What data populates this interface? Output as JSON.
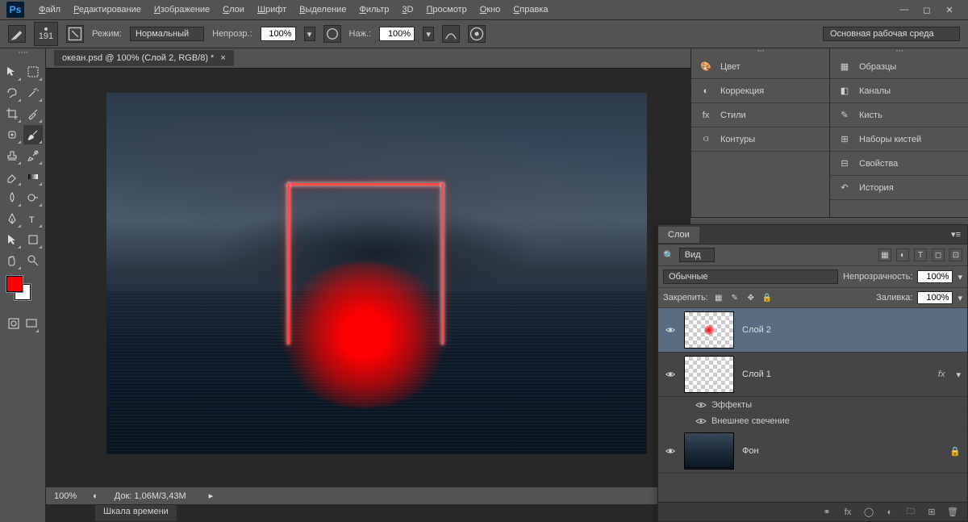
{
  "menubar": [
    "Файл",
    "Редактирование",
    "Изображение",
    "Слои",
    "Шрифт",
    "Выделение",
    "Фильтр",
    "3D",
    "Просмотр",
    "Окно",
    "Справка"
  ],
  "options": {
    "brush_size": "191",
    "mode_label": "Режим:",
    "mode_value": "Нормальный",
    "opacity_label": "Непрозр.:",
    "opacity_value": "100%",
    "flow_label": "Наж.:",
    "flow_value": "100%",
    "workspace": "Основная рабочая среда"
  },
  "document": {
    "tab_title": "океан.psd @ 100% (Слой 2, RGB/8) *",
    "zoom": "100%",
    "doc_info": "Док: 1,06M/3,43M",
    "timeline_tab": "Шкала времени"
  },
  "panels_left": [
    {
      "icon": "palette",
      "label": "Цвет"
    },
    {
      "icon": "adjust",
      "label": "Коррекция"
    },
    {
      "icon": "fx",
      "label": "Стили"
    },
    {
      "icon": "paths",
      "label": "Контуры"
    }
  ],
  "panels_right": [
    {
      "icon": "swatches",
      "label": "Образцы"
    },
    {
      "icon": "channels",
      "label": "Каналы"
    },
    {
      "icon": "brush",
      "label": "Кисть"
    },
    {
      "icon": "brushsets",
      "label": "Наборы кистей"
    },
    {
      "icon": "properties",
      "label": "Свойства"
    },
    {
      "icon": "history",
      "label": "История"
    }
  ],
  "layers_panel": {
    "title": "Слои",
    "kind_label": "Вид",
    "blend_mode": "Обычные",
    "opacity_label": "Непрозрачность:",
    "opacity_value": "100%",
    "lock_label": "Закрепить:",
    "fill_label": "Заливка:",
    "fill_value": "100%",
    "layers": [
      {
        "name": "Слой 2",
        "visible": true,
        "selected": true,
        "thumb": "red-dot"
      },
      {
        "name": "Слой 1",
        "visible": true,
        "thumb": "transparent",
        "fx": true
      },
      {
        "name": "Фон",
        "visible": true,
        "thumb": "ocean",
        "locked": true
      }
    ],
    "effects_label": "Эффекты",
    "effect_outer_glow": "Внешнее свечение"
  }
}
